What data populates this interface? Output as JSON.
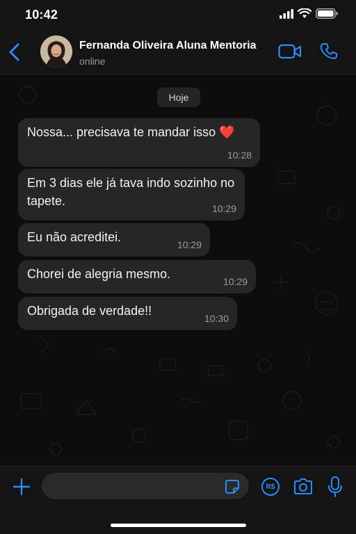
{
  "status_bar": {
    "time": "10:42"
  },
  "header": {
    "contact_name": "Fernanda Oliveira Aluna Mentoria",
    "contact_status": "online"
  },
  "chat": {
    "date_label": "Hoje",
    "messages": [
      {
        "text": "Nossa... precisava te mandar isso ❤️",
        "time": "10:28"
      },
      {
        "text": "Em 3 dias ele já tava indo sozinho no tapete.",
        "time": "10:29"
      },
      {
        "text": "Eu não acreditei.",
        "time": "10:29"
      },
      {
        "text": "Chorei de alegria mesmo.",
        "time": "10:29"
      },
      {
        "text": "Obrigada de verdade!!",
        "time": "10:30"
      }
    ]
  },
  "input_bar": {
    "message_value": "",
    "pix_label": "R$"
  },
  "colors": {
    "accent": "#2f8cff",
    "bubble": "#262626",
    "background": "#0d0d0d",
    "heart": "#e0245e"
  },
  "icons": [
    "back-icon",
    "video-call-icon",
    "phone-call-icon",
    "plus-icon",
    "sticker-icon",
    "pix-icon",
    "camera-icon",
    "microphone-icon",
    "signal-icon",
    "wifi-icon",
    "battery-icon"
  ]
}
